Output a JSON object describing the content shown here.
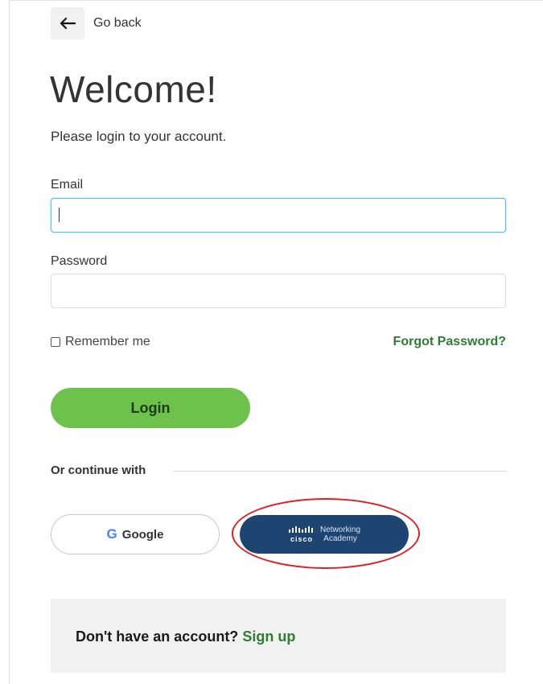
{
  "nav": {
    "back_label": "Go back"
  },
  "header": {
    "title": "Welcome!",
    "subtitle": "Please login to your account."
  },
  "form": {
    "email_label": "Email",
    "email_value": "",
    "password_label": "Password",
    "password_value": "",
    "remember_label": "Remember me",
    "remember_checked": false,
    "forgot_label": "Forgot Password?",
    "login_label": "Login"
  },
  "social": {
    "divider_label": "Or continue with",
    "google_icon_glyph": "G",
    "google_label": "Google",
    "cisco_wordmark": "cisco",
    "netacad_line1": "Networking",
    "netacad_line2": "Academy"
  },
  "signup": {
    "prompt": "Don't have an account?",
    "link_label": "Sign up"
  },
  "colors": {
    "primary_green": "#6cc24a",
    "link_green": "#2e7d32",
    "netacad_blue": "#1e4471",
    "focus_border": "#56c1e6",
    "highlight_red": "#e01e24"
  },
  "icons": {
    "back": "arrow-left-icon",
    "google": "google-g-icon",
    "cisco": "cisco-logo-icon"
  }
}
